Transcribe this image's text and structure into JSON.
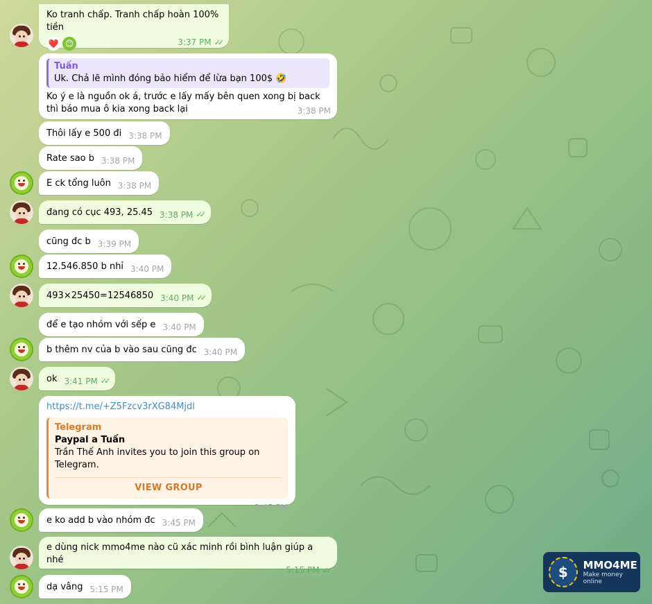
{
  "messages": [
    {
      "text": "Ko tranh chấp. Tranh chấp hoàn 100% tiền",
      "time": "3:37 PM",
      "reactions": [
        "❤️",
        "😊"
      ]
    },
    {
      "reply_name": "Tuấn",
      "reply_text": "Uk. Chả lẽ mình đóng bảo hiểm để lừa bạn 100$ 🤣",
      "text": "Ko ý e là nguồn ok á, trước e lấy mấy bên quen xong bị back thì báo mua ô kia xong back lại",
      "time": "3:38 PM"
    },
    {
      "text": "Thôi lấy e 500 đi",
      "time": "3:38 PM"
    },
    {
      "text": "Rate sao b",
      "time": "3:38 PM"
    },
    {
      "text": "E ck tổng luôn",
      "time": "3:38 PM"
    },
    {
      "text": "đang có cục 493, 25.45",
      "time": "3:38 PM"
    },
    {
      "text": "cũng đc b",
      "time": "3:39 PM"
    },
    {
      "text": "12.546.850 b nhỉ",
      "time": "3:40 PM"
    },
    {
      "text": "493×25450=12546850",
      "time": "3:40 PM"
    },
    {
      "text": "để e tạo nhóm với sếp e",
      "time": "3:40 PM"
    },
    {
      "text": "b thêm nv của b vào sau cũng đc",
      "time": "3:40 PM"
    },
    {
      "text": "ok",
      "time": "3:41 PM"
    },
    {
      "link": "https://t.me/+Z5Fzcv3rXG84Mjdl",
      "preview_source": "Telegram",
      "preview_title": "Paypal a Tuấn",
      "preview_desc": "Trần Thế Anh invites you to join this group on Telegram.",
      "preview_button": "VIEW GROUP",
      "time": "3:45 PM"
    },
    {
      "text": "e ko add b vào nhóm đc",
      "time": "3:45 PM"
    },
    {
      "text": "e dùng nick mmo4me nào cũ xác minh rồi bình luận giúp a nhé",
      "time": "5:15 PM"
    },
    {
      "text": "dạ vâng",
      "time": "5:15 PM"
    }
  ],
  "ticks": "✓✓",
  "logo": {
    "name": "MMO4ME",
    "tagline": "Make money online",
    "symbol": "$"
  },
  "colors": {
    "outgoing": "#effdde",
    "incoming": "#ffffff",
    "accent_link": "#3a8fd0",
    "preview_accent": "#d67a2a"
  }
}
